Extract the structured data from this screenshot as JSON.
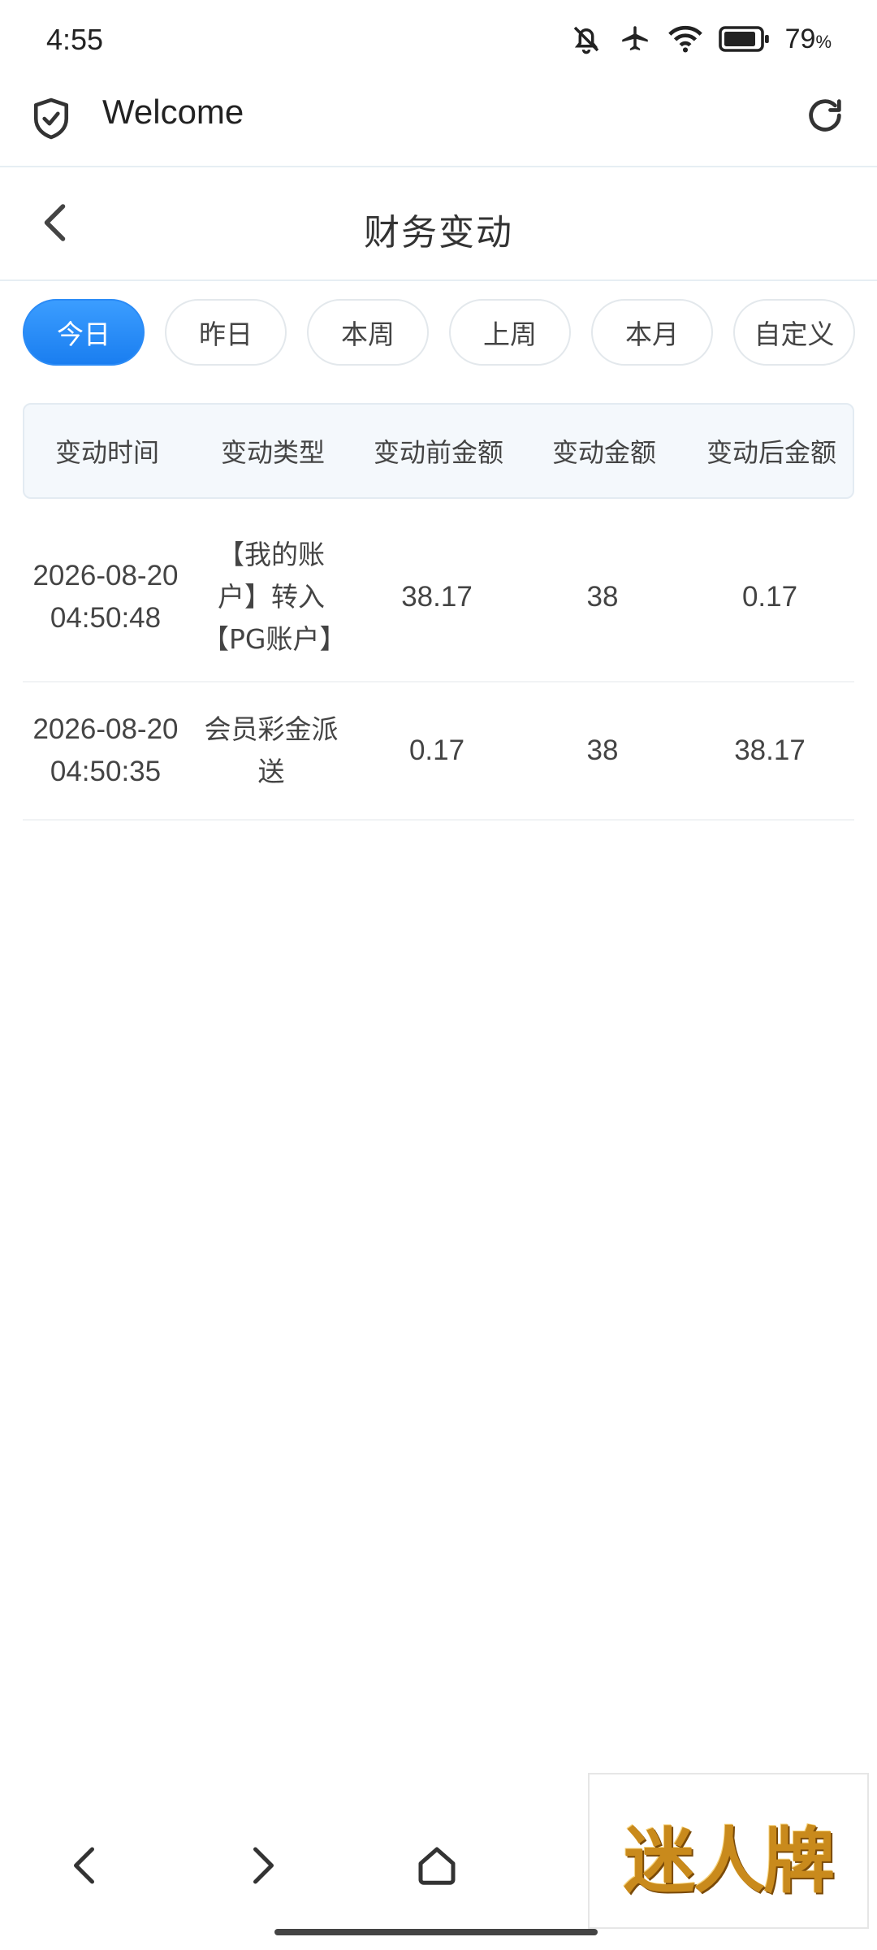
{
  "status_bar": {
    "time": "4:55",
    "battery_percent": "79",
    "battery_unit": "%",
    "icons": [
      "mute-bell-icon",
      "airplane-icon",
      "wifi-icon",
      "battery-icon"
    ]
  },
  "browser": {
    "title": "Welcome",
    "icons": [
      "shield-check-icon",
      "refresh-icon"
    ]
  },
  "page": {
    "title": "财务变动"
  },
  "filters": {
    "active_index": 0,
    "items": [
      "今日",
      "昨日",
      "本周",
      "上周",
      "本月",
      "自定义"
    ]
  },
  "table": {
    "columns": [
      "变动时间",
      "变动类型",
      "变动前金额",
      "变动金额",
      "变动后金额"
    ],
    "rows": [
      {
        "date": "2026-08-20",
        "time": "04:50:48",
        "type": "【我的账户】转入【PG账户】",
        "before": "38.17",
        "amount": "38",
        "after": "0.17"
      },
      {
        "date": "2026-08-20",
        "time": "04:50:35",
        "type": "会员彩金派送",
        "before": "0.17",
        "amount": "38",
        "after": "38.17"
      }
    ]
  },
  "watermark": {
    "text": "迷人牌",
    "color": "#c98a1c"
  },
  "colors": {
    "accent": "#2b8bf6",
    "header_bg": "#f4f8fc"
  }
}
